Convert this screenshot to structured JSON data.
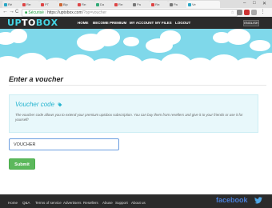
{
  "browser": {
    "tabs": [
      {
        "label": "Ré"
      },
      {
        "label": "Re:"
      },
      {
        "label": "PT"
      },
      {
        "label": "Bip"
      },
      {
        "label": "Re:"
      },
      {
        "label": "Da"
      },
      {
        "label": "Re:"
      },
      {
        "label": "Pa"
      },
      {
        "label": "Re:"
      },
      {
        "label": "Pa"
      },
      {
        "label": "Ve"
      }
    ],
    "window_controls": {
      "min": "–",
      "max": "□",
      "close": "✕"
    },
    "back": "←",
    "forward": "→",
    "reload": "C",
    "lock_label": "Sécurisé",
    "url_domain": "https://uptobox.com",
    "url_path": "/?op=voucher",
    "star": "☆"
  },
  "header": {
    "logo": [
      "U",
      "P",
      "T",
      "O",
      "B",
      "O",
      "X"
    ],
    "nav": [
      "HOME",
      "BECOME PREMIUM",
      "MY ACCOUNT",
      "MY FILES",
      "LOGOUT"
    ],
    "language": "ENGLISH"
  },
  "main": {
    "title": "Enter a voucher",
    "panel_title": "Voucher code",
    "panel_text": "The voucher code allows you to extend your premium uptobox subscription. You can buy them from resellers and give it to your friends or use it for yourself!",
    "voucher_value": "VOUCHER",
    "submit_label": "Submit"
  },
  "footer": {
    "links": [
      "Home",
      "Q&A",
      "Terms of service",
      "Advertisers",
      "Resellers",
      "Abuse",
      "Support",
      "About us"
    ],
    "facebook": "facebook"
  },
  "colors": {
    "accent": "#27b4cf",
    "header_bg": "#2b2b2b",
    "sky": "#7fd8ea",
    "submit": "#5cb85c",
    "panel_bg": "#e8f8fb"
  },
  "icons": {
    "voucher_tag": "tag-icon",
    "twitter": "twitter-icon",
    "lock": "lock-icon"
  }
}
